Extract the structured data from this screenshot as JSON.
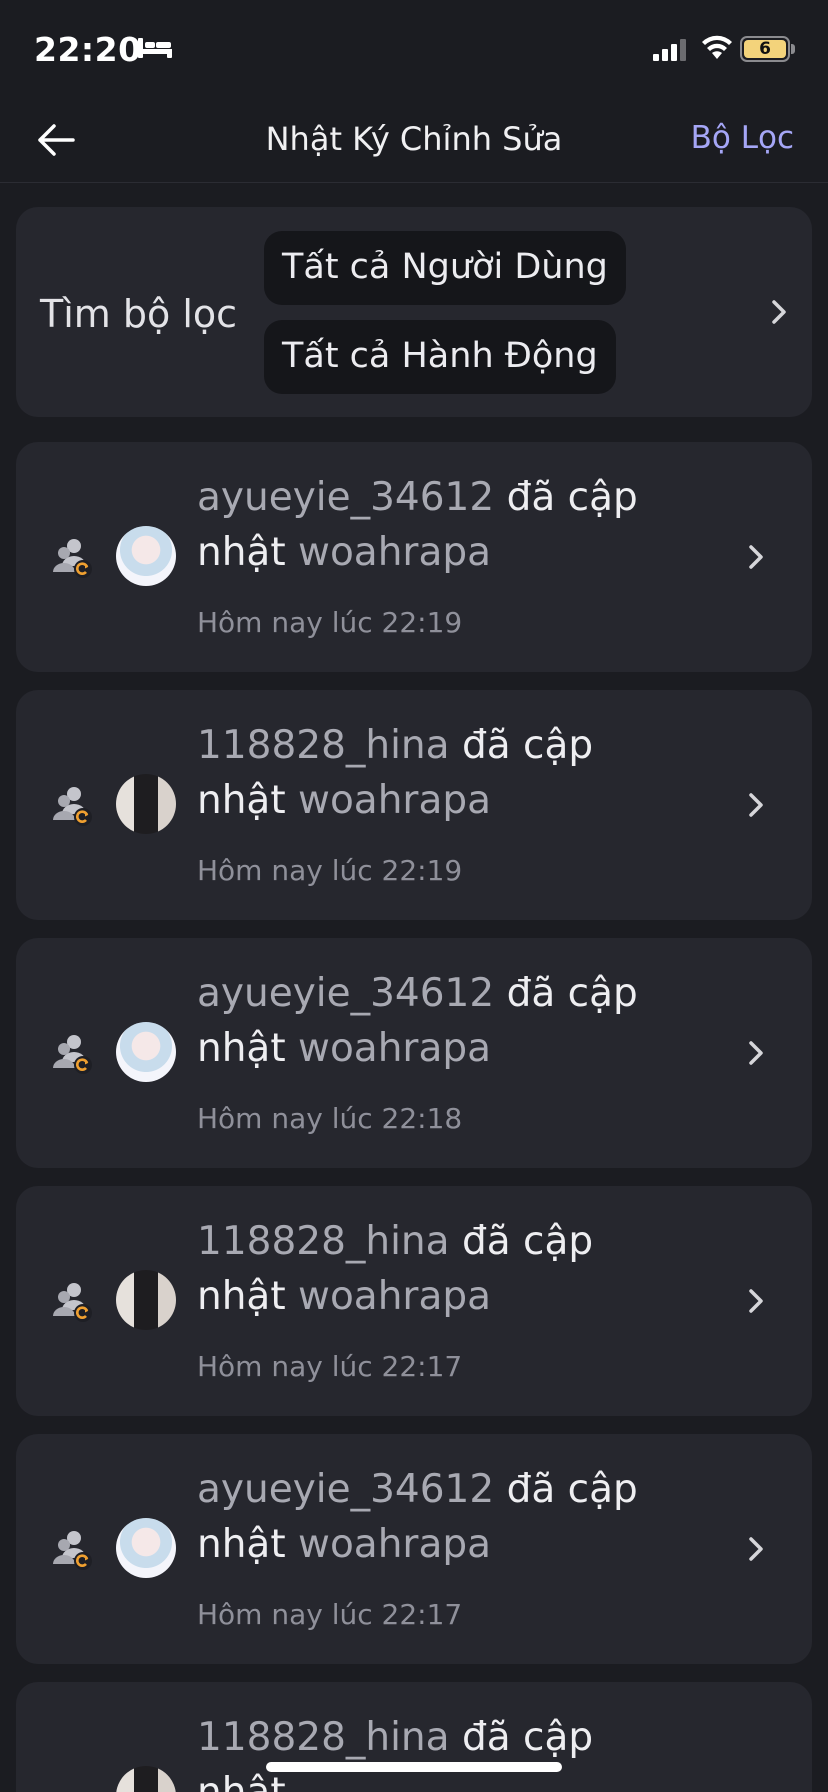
{
  "status_bar": {
    "time": "22:20",
    "battery": "6",
    "battery_level": 0.06,
    "icons": [
      "bed-icon",
      "signal-icon",
      "wifi-icon",
      "battery-icon"
    ]
  },
  "header": {
    "title": "Nhật Ký Chỉnh Sửa",
    "filter_label": "Bộ Lọc",
    "back_icon": "arrow-left-icon"
  },
  "filter": {
    "label": "Tìm bộ lọc",
    "users_chip": "Tất cả Người Dùng",
    "actions_chip": "Tất cả Hành Động"
  },
  "entries": [
    {
      "user": "ayueyie_34612",
      "action": "đã cập nhật",
      "target": "woahrapa",
      "time": "Hôm nay lúc 22:19"
    },
    {
      "user": "118828_hina",
      "action": "đã cập nhật",
      "target": "woahrapa",
      "time": "Hôm nay lúc 22:19"
    },
    {
      "user": "ayueyie_34612",
      "action": "đã cập nhật",
      "target": "woahrapa",
      "time": "Hôm nay lúc 22:18"
    },
    {
      "user": "118828_hina",
      "action": "đã cập nhật",
      "target": "woahrapa",
      "time": "Hôm nay lúc 22:17"
    },
    {
      "user": "ayueyie_34612",
      "action": "đã cập nhật",
      "target": "woahrapa",
      "time": "Hôm nay lúc 22:17"
    },
    {
      "user": "118828_hina",
      "action": "đã cập nhật",
      "target": "",
      "time": ""
    }
  ],
  "colors": {
    "background": "#1b1c21",
    "card": "#26272e",
    "accent": "#a5a6f6",
    "update_badge": "#f0a030"
  }
}
